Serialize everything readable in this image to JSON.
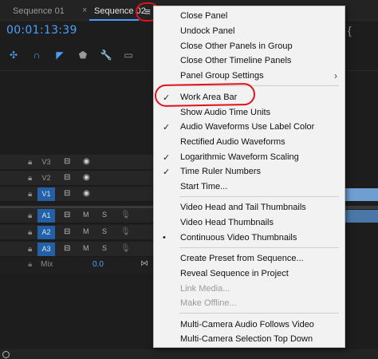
{
  "tabs": [
    {
      "label": "Sequence 01"
    },
    {
      "label": "Sequence 02",
      "close": "×"
    }
  ],
  "panel_menu_icon": "hamburger-icon",
  "timecode": "00:01:13:39",
  "toolbar": {
    "icons": [
      "snap-icon",
      "linked-selection-icon",
      "add-marker-icon",
      "marker-icon",
      "wrench-icon",
      "captions-icon"
    ]
  },
  "tracks": {
    "video": [
      {
        "name": "V3",
        "selected": false
      },
      {
        "name": "V2",
        "selected": false
      },
      {
        "name": "V1",
        "selected": true
      }
    ],
    "audio": [
      {
        "name": "A1",
        "mute": "M",
        "solo": "S"
      },
      {
        "name": "A2",
        "mute": "M",
        "solo": "S"
      },
      {
        "name": "A3",
        "mute": "M",
        "solo": "S"
      }
    ],
    "mix": {
      "label": "Mix",
      "value": "0.0"
    }
  },
  "menu": {
    "items": [
      {
        "label": "Close Panel"
      },
      {
        "label": "Undock Panel"
      },
      {
        "label": "Close Other Panels in Group"
      },
      {
        "label": "Close Other Timeline Panels"
      },
      {
        "label": "Panel Group Settings",
        "submenu": "›"
      },
      {
        "label": "Work Area Bar",
        "check": "✓"
      },
      {
        "label": "Show Audio Time Units"
      },
      {
        "label": "Audio Waveforms Use Label Color",
        "check": "✓"
      },
      {
        "label": "Rectified Audio Waveforms"
      },
      {
        "label": "Logarithmic Waveform Scaling",
        "check": "✓"
      },
      {
        "label": "Time Ruler Numbers",
        "check": "✓"
      },
      {
        "label": "Start Time..."
      },
      {
        "label": "Video Head and Tail Thumbnails"
      },
      {
        "label": "Video Head Thumbnails"
      },
      {
        "label": "Continuous Video Thumbnails",
        "check": "•"
      },
      {
        "label": "Create Preset from Sequence..."
      },
      {
        "label": "Reveal Sequence in Project"
      },
      {
        "label": "Link Media...",
        "disabled": true
      },
      {
        "label": "Make Offline...",
        "disabled": true
      },
      {
        "label": "Multi-Camera Audio Follows Video"
      },
      {
        "label": "Multi-Camera Selection Top Down"
      }
    ]
  },
  "colors": {
    "accent": "#4aa0ff",
    "highlight_ring": "#e0121b",
    "menu_bg": "#f2f2f2",
    "panel_bg": "#1d1d1d"
  }
}
